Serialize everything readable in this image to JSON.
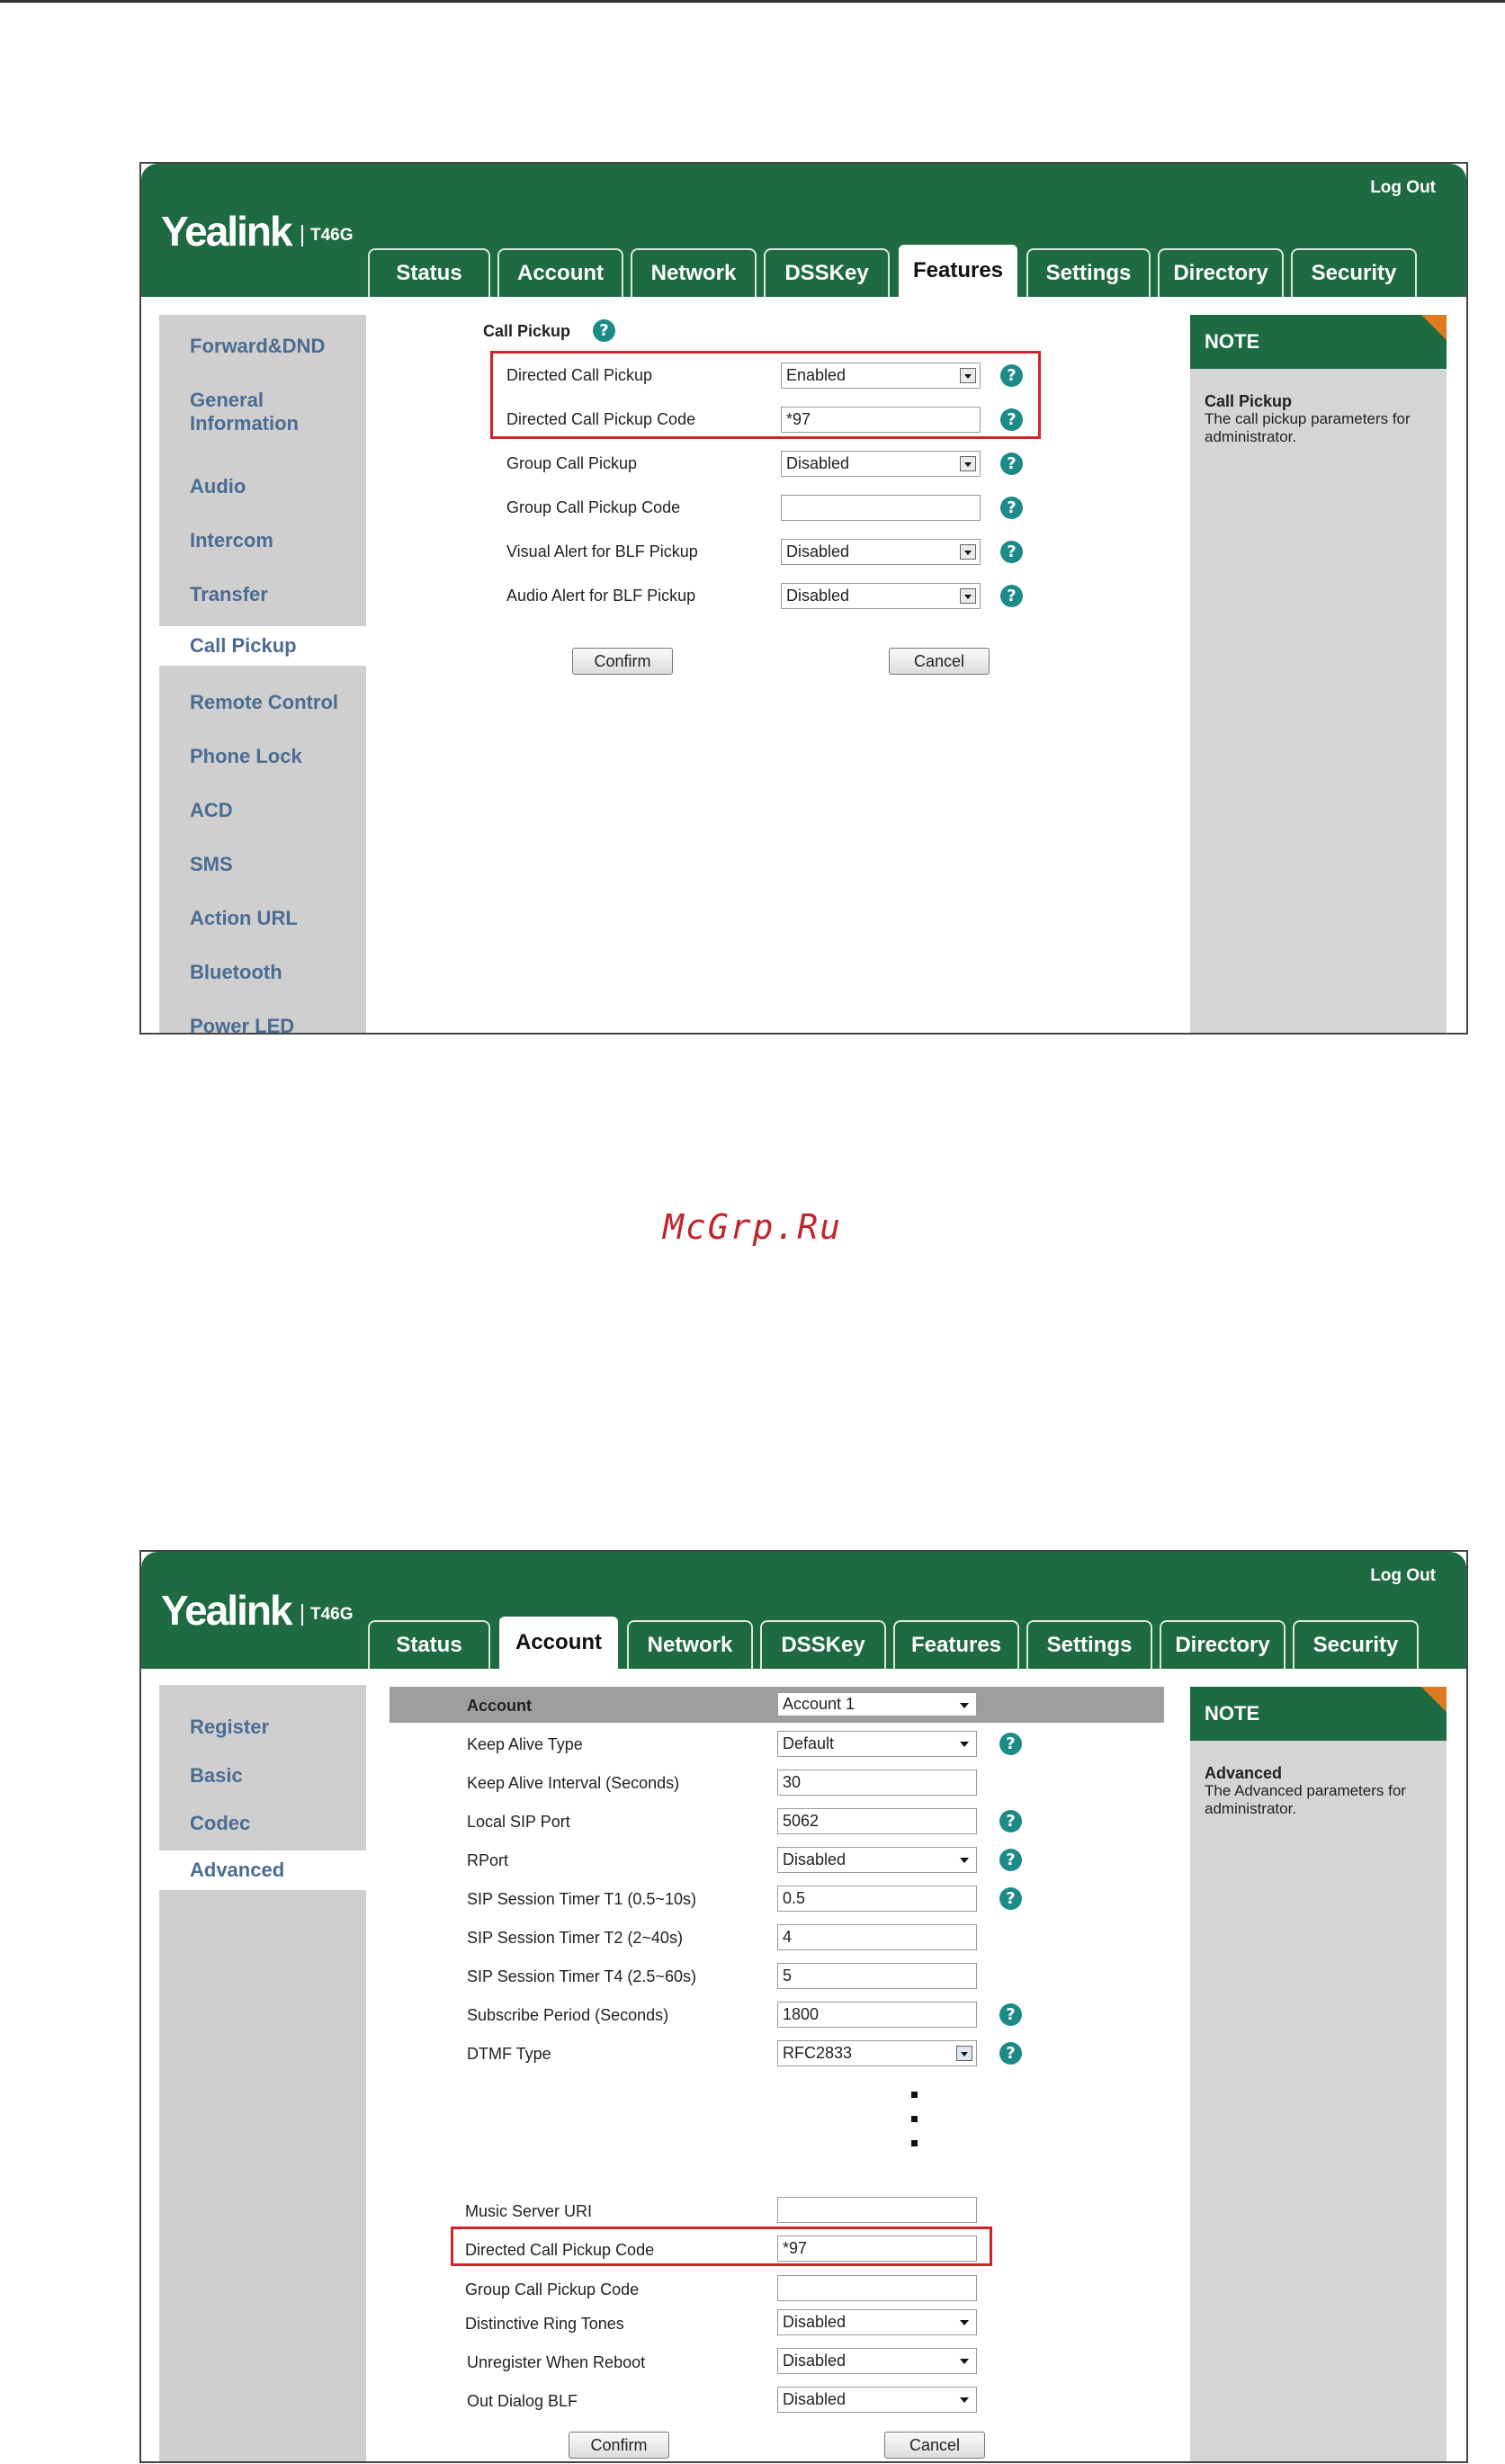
{
  "shot1": {
    "logo": "Yealink",
    "model": "T46G",
    "logout": "Log Out",
    "tabs": [
      "Status",
      "Account",
      "Network",
      "DSSKey",
      "Features",
      "Settings",
      "Directory",
      "Security"
    ],
    "active_tab": "Features",
    "sidebar": [
      "Forward&DND",
      "General Information",
      "Audio",
      "Intercom",
      "Transfer",
      "Call Pickup",
      "Remote Control",
      "Phone Lock",
      "ACD",
      "SMS",
      "Action URL",
      "Bluetooth",
      "Power LED"
    ],
    "active_sidebar": "Call Pickup",
    "section_title": "Call Pickup",
    "rows": [
      {
        "label": "Directed Call Pickup",
        "type": "select",
        "value": "Enabled"
      },
      {
        "label": "Directed Call Pickup Code",
        "type": "text",
        "value": "*97"
      },
      {
        "label": "Group Call Pickup",
        "type": "select",
        "value": "Disabled"
      },
      {
        "label": "Group Call Pickup Code",
        "type": "text",
        "value": ""
      },
      {
        "label": "Visual Alert for BLF Pickup",
        "type": "select",
        "value": "Disabled"
      },
      {
        "label": "Audio Alert for BLF Pickup",
        "type": "select",
        "value": "Disabled"
      }
    ],
    "confirm": "Confirm",
    "cancel": "Cancel",
    "note": {
      "head": "NOTE",
      "title": "Call Pickup",
      "text": "The call pickup parameters for administrator."
    }
  },
  "watermark": "McGrp.Ru",
  "shot2": {
    "logo": "Yealink",
    "model": "T46G",
    "logout": "Log Out",
    "tabs": [
      "Status",
      "Account",
      "Network",
      "DSSKey",
      "Features",
      "Settings",
      "Directory",
      "Security"
    ],
    "active_tab": "Account",
    "sidebar": [
      "Register",
      "Basic",
      "Codec",
      "Advanced"
    ],
    "active_sidebar": "Advanced",
    "account_label": "Account",
    "account_value": "Account 1",
    "rows_top": [
      {
        "label": "Keep Alive Type",
        "type": "select",
        "value": "Default",
        "help": true
      },
      {
        "label": "Keep Alive Interval (Seconds)",
        "type": "text",
        "value": "30",
        "help": false
      },
      {
        "label": "Local SIP Port",
        "type": "text",
        "value": "5062",
        "help": true
      },
      {
        "label": "RPort",
        "type": "select",
        "value": "Disabled",
        "help": true
      },
      {
        "label": "SIP Session Timer T1 (0.5~10s)",
        "type": "text",
        "value": "0.5",
        "help": true
      },
      {
        "label": "SIP Session Timer T2 (2~40s)",
        "type": "text",
        "value": "4",
        "help": false
      },
      {
        "label": "SIP Session Timer T4 (2.5~60s)",
        "type": "text",
        "value": "5",
        "help": false
      },
      {
        "label": "Subscribe Period (Seconds)",
        "type": "text",
        "value": "1800",
        "help": true
      },
      {
        "label": "DTMF Type",
        "type": "select",
        "value": "RFC2833",
        "help": true
      }
    ],
    "rows_bottom": [
      {
        "label": "Music Server URI",
        "type": "text",
        "value": ""
      },
      {
        "label": "Directed Call Pickup Code",
        "type": "text",
        "value": "*97"
      },
      {
        "label": "Group Call Pickup Code",
        "type": "text",
        "value": ""
      },
      {
        "label": "Distinctive Ring Tones",
        "type": "select",
        "value": "Disabled"
      },
      {
        "label": "Unregister When Reboot",
        "type": "select",
        "value": "Disabled"
      },
      {
        "label": "Out Dialog BLF",
        "type": "select",
        "value": "Disabled"
      }
    ],
    "confirm": "Confirm",
    "cancel": "Cancel",
    "note": {
      "head": "NOTE",
      "title": "Advanced",
      "text": "The Advanced parameters for administrator."
    }
  },
  "colors": {
    "header_green": "#1e6b41",
    "highlight_red": "#d2232a",
    "help_teal": "#1c8a86",
    "note_orange": "#e07a1f",
    "link_blue": "#4b6c92"
  }
}
